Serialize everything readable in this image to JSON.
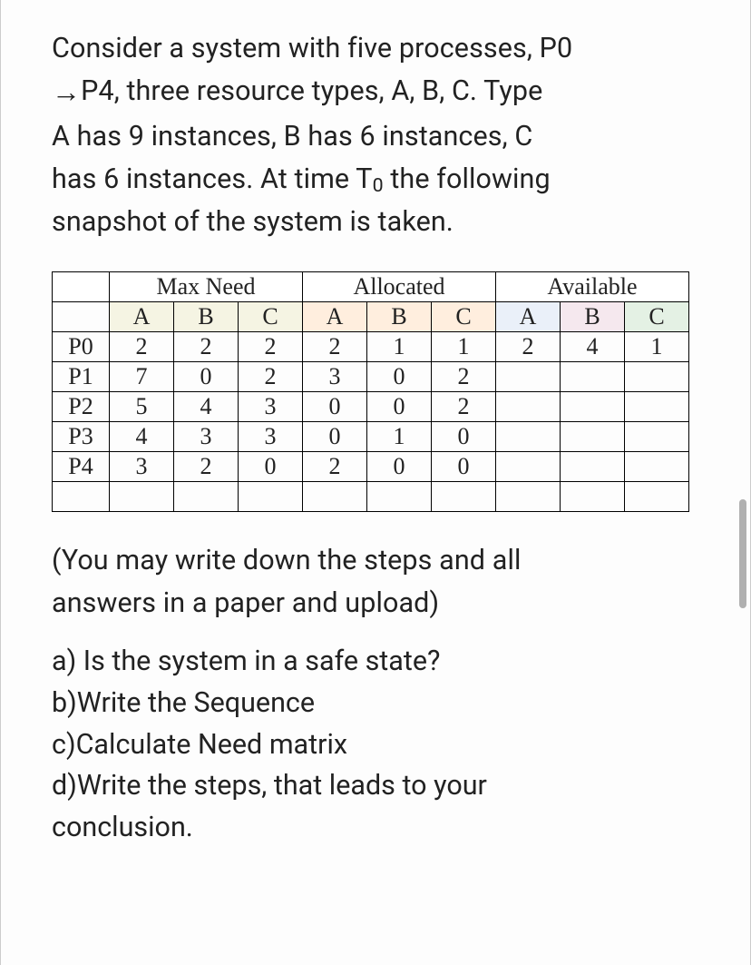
{
  "intro": {
    "line1a": "Consider a system with five processes, P0",
    "arrow": "→",
    "line2a": "P4, three resource types, A, B, C. Type",
    "line3": "A has 9 instances, B has 6 instances, C",
    "line4a": "has 6 instances. At time T",
    "line4sub": "0",
    "line4b": " the following",
    "line5": "snapshot of the system is taken."
  },
  "table": {
    "groups": {
      "max": "Max Need",
      "alloc": "Allocated",
      "avail": "Available"
    },
    "cols": [
      "A",
      "B",
      "C",
      "A",
      "B",
      "C",
      "A",
      "B",
      "C"
    ],
    "rows": [
      {
        "p": "P0",
        "max": [
          "2",
          "2",
          "2"
        ],
        "alloc": [
          "2",
          "1",
          "1"
        ],
        "avail": [
          "2",
          "4",
          "1"
        ]
      },
      {
        "p": "P1",
        "max": [
          "7",
          "0",
          "2"
        ],
        "alloc": [
          "3",
          "0",
          "2"
        ],
        "avail": [
          "",
          "",
          ""
        ]
      },
      {
        "p": "P2",
        "max": [
          "5",
          "4",
          "3"
        ],
        "alloc": [
          "0",
          "0",
          "2"
        ],
        "avail": [
          "",
          "",
          ""
        ]
      },
      {
        "p": "P3",
        "max": [
          "4",
          "3",
          "3"
        ],
        "alloc": [
          "0",
          "1",
          "0"
        ],
        "avail": [
          "",
          "",
          ""
        ]
      },
      {
        "p": "P4",
        "max": [
          "3",
          "2",
          "0"
        ],
        "alloc": [
          "2",
          "0",
          "0"
        ],
        "avail": [
          "",
          "",
          ""
        ]
      }
    ]
  },
  "note": {
    "line1": "(You may write down the steps and all",
    "line2": "answers in a paper and upload)"
  },
  "questions": {
    "a": "a) Is the system in a safe state?",
    "b": "b)Write the Sequence",
    "c": "c)Calculate Need matrix",
    "d1": "d)Write the steps, that leads to your",
    "d2": "conclusion."
  }
}
